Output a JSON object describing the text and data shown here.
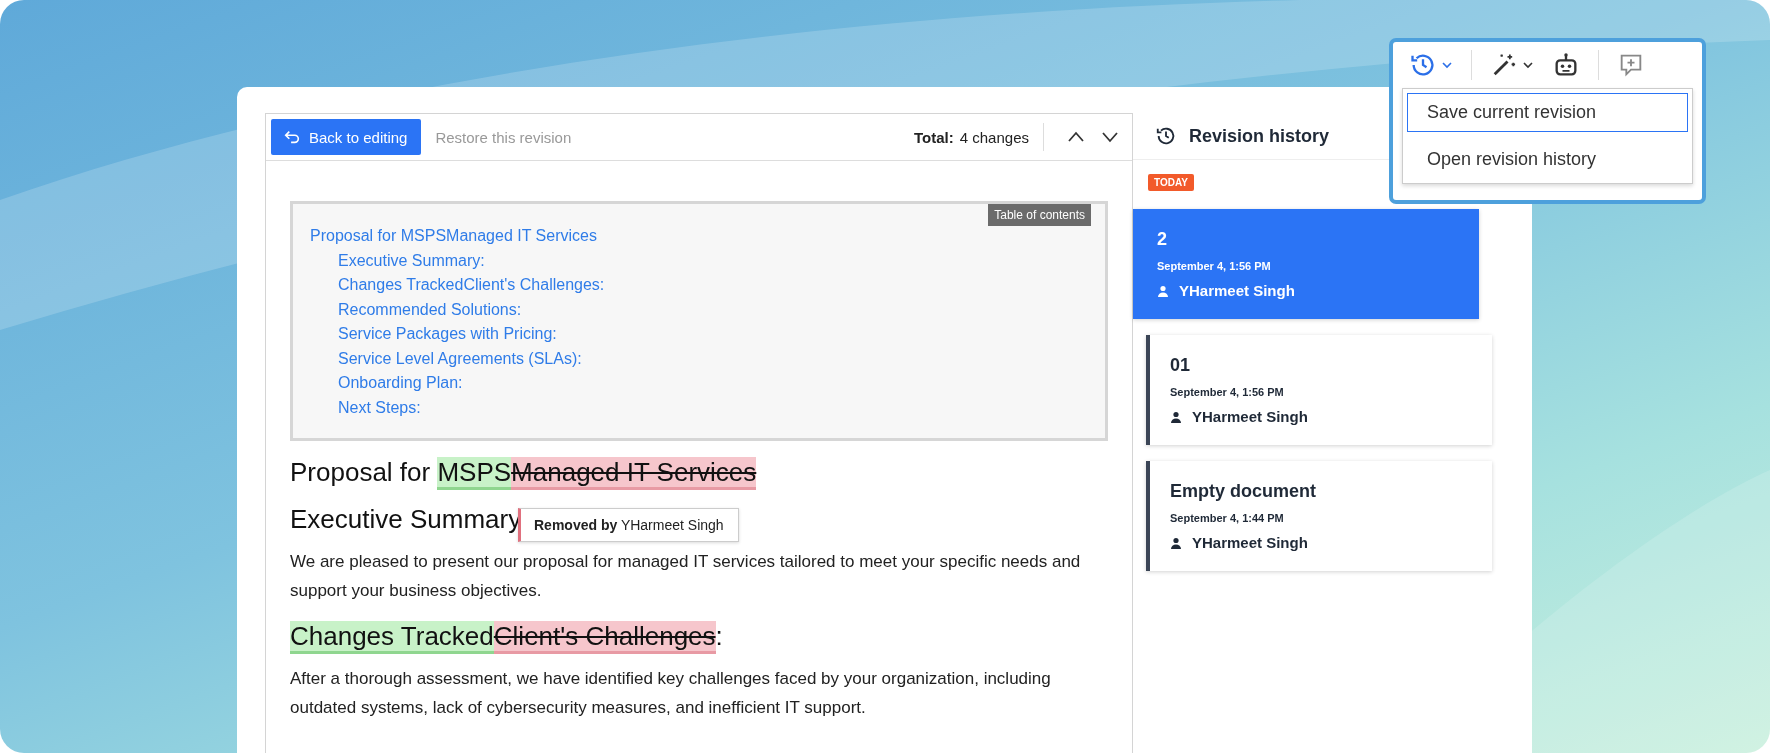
{
  "toolbar": {
    "back_button": "Back to editing",
    "restore_link": "Restore this revision",
    "total_label": "Total:",
    "total_value": "4 changes"
  },
  "toc": {
    "badge": "Table of contents",
    "items": [
      {
        "label": "Proposal for MSPSManaged IT Services",
        "children": [
          {
            "label": "Executive Summary:"
          },
          {
            "label": "Changes TrackedClient's Challenges:"
          },
          {
            "label": "Recommended Solutions:"
          },
          {
            "label": "Service Packages with Pricing:"
          },
          {
            "label": "Service Level Agreements (SLAs):"
          },
          {
            "label": "Onboarding Plan:"
          },
          {
            "label": "Next Steps:"
          }
        ]
      }
    ]
  },
  "document": [
    {
      "kind": "heading",
      "parts": [
        {
          "text": "Proposal for ",
          "kind": "plain"
        },
        {
          "text": "MSPS",
          "kind": "added"
        },
        {
          "text": "Managed IT Services",
          "kind": "removed"
        }
      ]
    },
    {
      "kind": "heading",
      "parts": [
        {
          "text": "Executive Summary",
          "kind": "plain"
        }
      ]
    },
    {
      "kind": "paragraph",
      "parts": [
        {
          "text": "We are pleased to present our proposal for managed IT services tailored to meet your specific needs and support your business objectives.",
          "kind": "plain"
        }
      ]
    },
    {
      "kind": "heading",
      "parts": [
        {
          "text": "Changes Tracked",
          "kind": "added"
        },
        {
          "text": "Client's Challenges",
          "kind": "removed"
        },
        {
          "text": ":",
          "kind": "plain"
        }
      ]
    },
    {
      "kind": "paragraph",
      "parts": [
        {
          "text": "After a thorough assessment, we have identified key challenges faced by your organization, including outdated systems, lack of cybersecurity measures, and inefficient IT support.",
          "kind": "plain"
        }
      ]
    }
  ],
  "tooltip": {
    "label": "Removed by",
    "author": "YHarmeet Singh"
  },
  "sidebar": {
    "title": "Revision history",
    "group_label": "TODAY",
    "revisions": [
      {
        "name": "2",
        "date": "September 4, 1:56 PM",
        "author": "YHarmeet Singh",
        "selected": true
      },
      {
        "name": "01",
        "date": "September 4, 1:56 PM",
        "author": "YHarmeet Singh",
        "selected": false
      },
      {
        "name": "Empty document",
        "date": "September 4, 1:44 PM",
        "author": "YHarmeet Singh",
        "selected": false
      }
    ]
  },
  "menu": {
    "items": [
      {
        "label": "Save current revision",
        "selected": true
      },
      {
        "label": "Open revision history",
        "selected": false
      }
    ]
  }
}
